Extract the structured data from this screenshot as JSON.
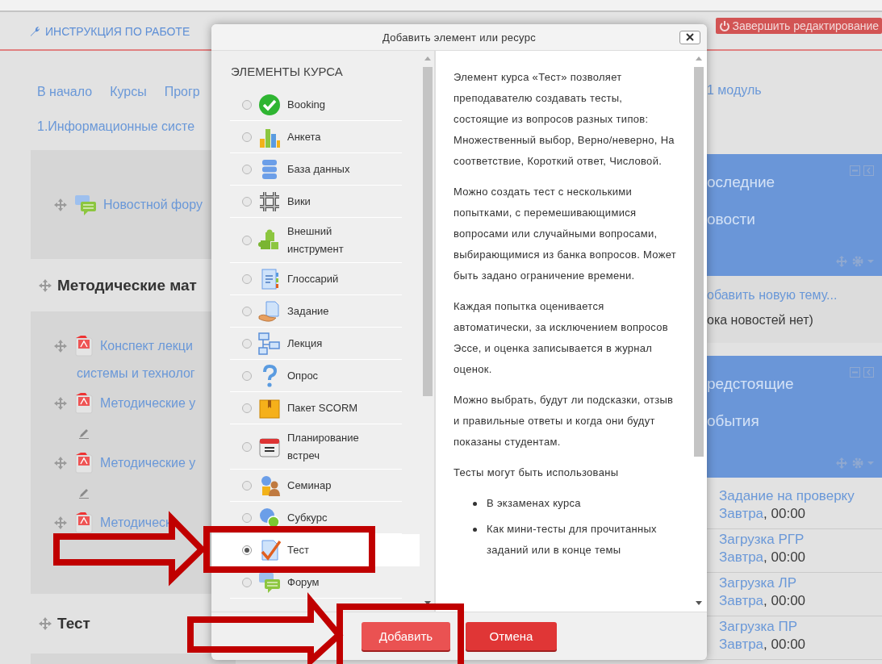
{
  "header": {
    "title": "ИНСТРУКЦИЯ ПО РАБОТЕ",
    "edit_button": "Завершить редактирование"
  },
  "breadcrumb": [
    "В начало",
    "Курсы",
    "Прогр"
  ],
  "breadcrumb_end": "1 модуль",
  "course_link": "1.Информационные систе",
  "sections": [
    {
      "items": [
        {
          "kind": "forum",
          "lines": [
            "Новостной фору"
          ],
          "editable": false
        }
      ]
    },
    {
      "title": "Методические мат",
      "items": [
        {
          "kind": "pdf",
          "lines": [
            "Конспект лекци",
            "системы и технолог"
          ],
          "editable": false
        },
        {
          "kind": "pdf",
          "lines": [
            "Методические у"
          ],
          "editable": true
        },
        {
          "kind": "pdf",
          "lines": [
            "Методические у"
          ],
          "editable": true
        },
        {
          "kind": "pdf",
          "lines": [
            "Методическ"
          ],
          "editable": false
        }
      ]
    },
    {
      "title": "Тест"
    }
  ],
  "blocks": [
    {
      "title_lines": [
        "оследние",
        "овости"
      ],
      "link": "обавить новую тему...",
      "note": "ока новостей нет)"
    },
    {
      "title_lines": [
        "редстоящие",
        "обытия"
      ],
      "events": [
        {
          "title": "Задание на проверку",
          "day": "Завтра",
          "time": ", 00:00"
        },
        {
          "title": "Загрузка РГР",
          "day": "Завтра",
          "time": ", 00:00"
        },
        {
          "title": "Загрузка ЛР",
          "day": "Завтра",
          "time": ", 00:00"
        },
        {
          "title": "Загрузка ПР",
          "day": "Завтра",
          "time": ", 00:00"
        }
      ]
    }
  ],
  "dialog": {
    "title": "Добавить элемент или ресурс",
    "list_heading": "ЭЛЕМЕНТЫ КУРСА",
    "items": [
      {
        "label": "Booking",
        "selected": false
      },
      {
        "label": "Анкета",
        "selected": false
      },
      {
        "label": "База данных",
        "selected": false
      },
      {
        "label": "Вики",
        "selected": false
      },
      {
        "label": "Внешний инструмент",
        "selected": false
      },
      {
        "label": "Глоссарий",
        "selected": false
      },
      {
        "label": "Задание",
        "selected": false
      },
      {
        "label": "Лекция",
        "selected": false
      },
      {
        "label": "Опрос",
        "selected": false
      },
      {
        "label": "Пакет SCORM",
        "selected": false
      },
      {
        "label": "Планирование встреч",
        "selected": false
      },
      {
        "label": "Семинар",
        "selected": false
      },
      {
        "label": "Субкурс",
        "selected": false
      },
      {
        "label": "Тест",
        "selected": true
      },
      {
        "label": "Форум",
        "selected": false
      }
    ],
    "description": {
      "paragraphs": [
        "Элемент курса «Тест» позволяет преподавателю создавать тесты, состоящие из вопросов разных типов: Множественный выбор, Верно/неверно, На соответствие, Короткий ответ, Числовой.",
        "Можно создать тест с несколькими попытками, с перемешивающимися вопросами или случайными вопросами, выбирающимися из банка вопросов. Может быть задано ограничение времени.",
        "Каждая попытка оценивается автоматически, за исключением вопросов Эссе, и оценка записывается в журнал оценок.",
        "Можно выбрать, будут ли подсказки, отзыв и правильные ответы и когда они будут показаны студентам.",
        "Тесты могут быть использованы"
      ],
      "bullets": [
        "В экзаменах курса",
        "Как мини-тесты для прочитанных заданий или в конце темы"
      ]
    },
    "buttons": [
      {
        "label": "Добавить",
        "kind": "primary"
      },
      {
        "label": "Отмена",
        "kind": "cancel"
      }
    ]
  }
}
